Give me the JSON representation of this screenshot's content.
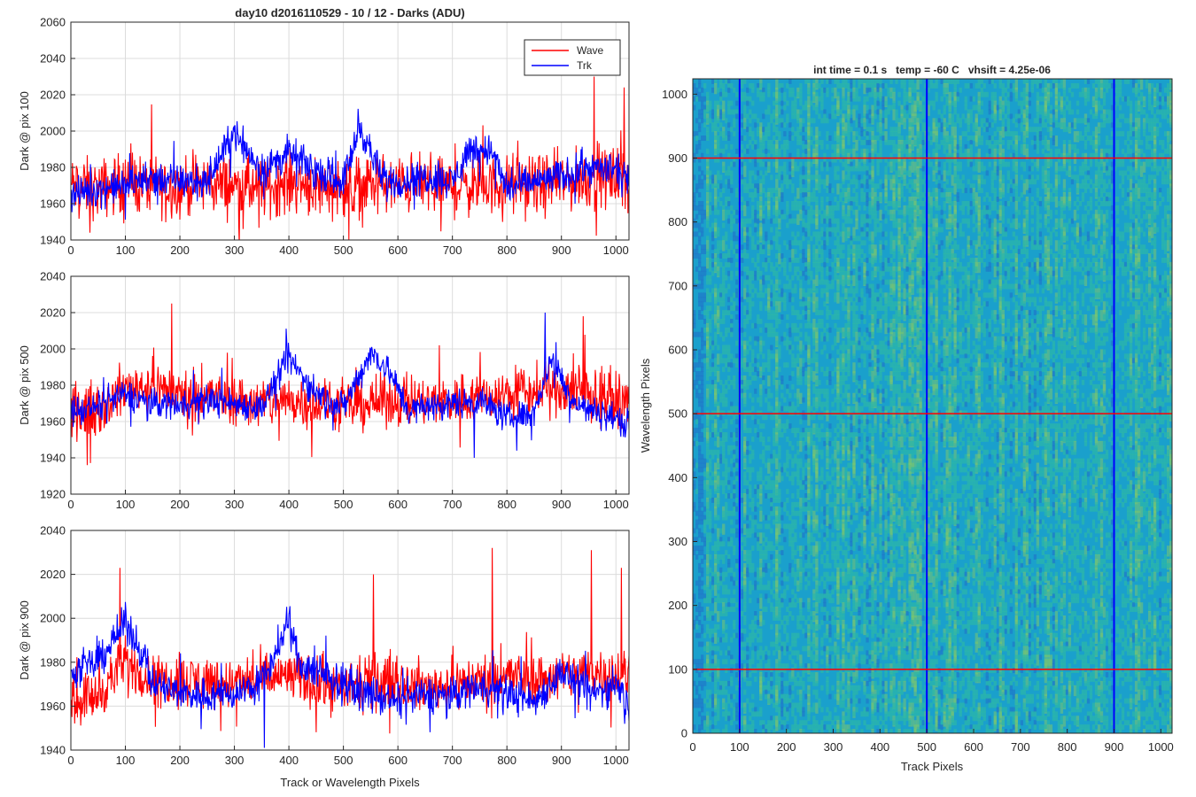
{
  "figure": {
    "title": "day10 d2016110529 - 10 / 12 - Darks (ADU)",
    "xlabel_left": "Track or Wavelength Pixels"
  },
  "legend": {
    "entries": [
      {
        "name": "Wave",
        "color": "#ff0000"
      },
      {
        "name": "Trk",
        "color": "#0000ff"
      }
    ]
  },
  "chart_data": [
    {
      "type": "line",
      "ylabel": "Dark @ pix 100",
      "xlim": [
        0,
        1024
      ],
      "ylim": [
        1940,
        2060
      ],
      "x_ticks": [
        0,
        100,
        200,
        300,
        400,
        500,
        600,
        700,
        800,
        900,
        1000
      ],
      "y_ticks": [
        1940,
        1960,
        1980,
        2000,
        2020,
        2040,
        2060
      ],
      "grid": true,
      "legend": "top-right",
      "series": [
        {
          "name": "Wave",
          "color": "#ff0000",
          "x": [
            0,
            50,
            100,
            150,
            200,
            250,
            300,
            350,
            400,
            450,
            500,
            550,
            600,
            650,
            700,
            750,
            800,
            850,
            900,
            950,
            1000,
            1024
          ],
          "values": [
            1970,
            1968,
            1972,
            1970,
            1969,
            1971,
            1970,
            1968,
            1972,
            1970,
            1969,
            1971,
            1970,
            1972,
            1969,
            1970,
            1971,
            1970,
            1972,
            1973,
            1975,
            1972
          ],
          "noise": 14,
          "spikes": [
            [
              960,
              2030
            ],
            [
              1015,
              2024
            ],
            [
              510,
              1940
            ],
            [
              35,
              1944
            ]
          ]
        },
        {
          "name": "Trk",
          "color": "#0000ff",
          "x": [
            0,
            50,
            100,
            150,
            200,
            250,
            300,
            350,
            400,
            450,
            500,
            530,
            570,
            600,
            650,
            700,
            730,
            770,
            800,
            850,
            900,
            950,
            1000,
            1024
          ],
          "values": [
            1965,
            1968,
            1970,
            1975,
            1972,
            1972,
            2000,
            1978,
            1988,
            1978,
            1972,
            2003,
            1974,
            1972,
            1975,
            1972,
            1990,
            1990,
            1968,
            1972,
            1975,
            1980,
            1978,
            1970
          ],
          "noise": 8,
          "spikes": []
        }
      ]
    },
    {
      "type": "line",
      "ylabel": "Dark @ pix 500",
      "xlim": [
        0,
        1024
      ],
      "ylim": [
        1920,
        2040
      ],
      "x_ticks": [
        0,
        100,
        200,
        300,
        400,
        500,
        600,
        700,
        800,
        900,
        1000
      ],
      "y_ticks": [
        1920,
        1940,
        1960,
        1980,
        2000,
        2020,
        2040
      ],
      "grid": true,
      "series": [
        {
          "name": "Wave",
          "color": "#ff0000",
          "x": [
            0,
            50,
            100,
            150,
            200,
            250,
            300,
            350,
            400,
            450,
            500,
            550,
            600,
            650,
            700,
            750,
            800,
            850,
            900,
            950,
            1000,
            1024
          ],
          "values": [
            1965,
            1966,
            1978,
            1980,
            1975,
            1974,
            1972,
            1970,
            1972,
            1970,
            1968,
            1970,
            1972,
            1970,
            1972,
            1974,
            1975,
            1976,
            1978,
            1975,
            1972,
            1970
          ],
          "noise": 12,
          "spikes": [
            [
              185,
              2025
            ],
            [
              30,
              1936
            ],
            [
              940,
              2018
            ]
          ]
        },
        {
          "name": "Trk",
          "color": "#0000ff",
          "x": [
            0,
            50,
            100,
            150,
            200,
            250,
            300,
            350,
            400,
            450,
            500,
            550,
            580,
            620,
            650,
            700,
            750,
            800,
            850,
            880,
            920,
            950,
            1000,
            1024
          ],
          "values": [
            1965,
            1968,
            1975,
            1970,
            1970,
            1972,
            1970,
            1968,
            1995,
            1975,
            1968,
            1998,
            1990,
            1966,
            1968,
            1970,
            1972,
            1962,
            1965,
            1995,
            1972,
            1966,
            1962,
            1958
          ],
          "noise": 7,
          "spikes": [
            [
              870,
              2020
            ],
            [
              740,
              1940
            ]
          ]
        }
      ]
    },
    {
      "type": "line",
      "ylabel": "Dark @ pix 900",
      "xlim": [
        0,
        1024
      ],
      "ylim": [
        1940,
        2040
      ],
      "x_ticks": [
        0,
        100,
        200,
        300,
        400,
        500,
        600,
        700,
        800,
        900,
        1000
      ],
      "y_ticks": [
        1940,
        1960,
        1980,
        2000,
        2020,
        2040
      ],
      "grid": true,
      "series": [
        {
          "name": "Wave",
          "color": "#ff0000",
          "x": [
            0,
            50,
            100,
            150,
            200,
            250,
            300,
            350,
            400,
            450,
            500,
            550,
            600,
            650,
            700,
            750,
            800,
            850,
            900,
            950,
            1000,
            1024
          ],
          "values": [
            1962,
            1965,
            1980,
            1972,
            1972,
            1972,
            1970,
            1972,
            1974,
            1970,
            1968,
            1970,
            1972,
            1968,
            1970,
            1972,
            1974,
            1972,
            1974,
            1976,
            1975,
            1972
          ],
          "noise": 10,
          "spikes": [
            [
              90,
              2023
            ],
            [
              773,
              2032
            ],
            [
              955,
              2031
            ],
            [
              1010,
              2023
            ],
            [
              555,
              2020
            ]
          ]
        },
        {
          "name": "Trk",
          "color": "#0000ff",
          "x": [
            0,
            50,
            100,
            130,
            150,
            200,
            250,
            300,
            350,
            400,
            420,
            450,
            500,
            550,
            600,
            650,
            700,
            750,
            800,
            850,
            900,
            950,
            1000,
            1024
          ],
          "values": [
            1975,
            1980,
            1998,
            1985,
            1970,
            1966,
            1965,
            1966,
            1970,
            1998,
            1980,
            1975,
            1970,
            1965,
            1962,
            1965,
            1965,
            1970,
            1966,
            1962,
            1976,
            1965,
            1970,
            1960
          ],
          "noise": 7,
          "spikes": [
            [
              355,
              1941
            ]
          ]
        }
      ]
    },
    {
      "type": "heatmap",
      "title": "int time = 0.1 s   temp = -60 C   vhsift = 4.25e-06",
      "xlabel": "Track Pixels",
      "ylabel": "Wavelength Pixels",
      "xlim": [
        0,
        1024
      ],
      "ylim": [
        0,
        1024
      ],
      "x_ticks": [
        0,
        100,
        200,
        300,
        400,
        500,
        600,
        700,
        800,
        900,
        1000
      ],
      "y_ticks": [
        0,
        100,
        200,
        300,
        400,
        500,
        600,
        700,
        800,
        900,
        1000
      ],
      "colormap": [
        "#1f78c9",
        "#1aa0cc",
        "#2cb7a8",
        "#7cc76e"
      ],
      "vlines": {
        "x": [
          100,
          500,
          900
        ],
        "color": "#0000ff"
      },
      "hlines": {
        "y": [
          100,
          500,
          900
        ],
        "color": "#ff0000"
      }
    }
  ]
}
